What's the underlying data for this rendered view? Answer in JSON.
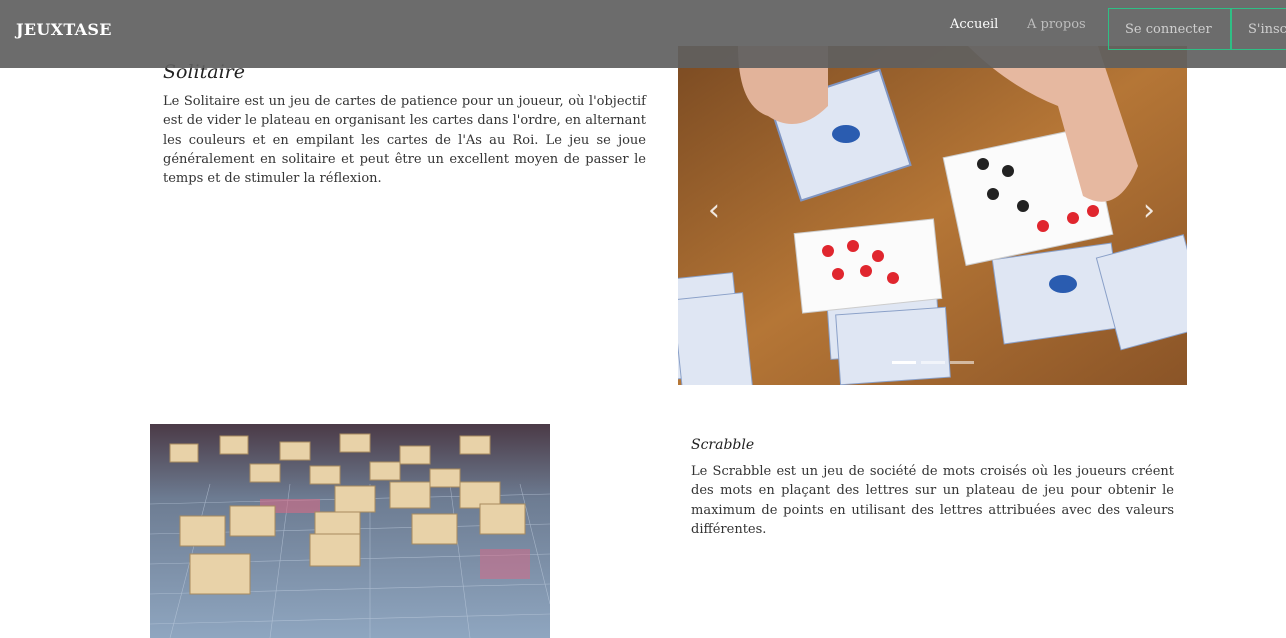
{
  "navbar": {
    "brand": "JEUXTASE",
    "links": [
      {
        "label": "Accueil",
        "active": true
      },
      {
        "label": "A propos",
        "active": false
      }
    ],
    "login_button": "Se connecter",
    "signup_button": "S'inscrire",
    "accent_color": "#2fbf85"
  },
  "solitaire": {
    "title": "Solitaire",
    "description": "Le Solitaire est un jeu de cartes de patience pour un joueur, où l'objectif est de vider le plateau en organisant les cartes dans l'ordre, en alternant les couleurs et en empilant les cartes de l'As au Roi. Le jeu se joue généralement en solitaire et peut être un excellent moyen de passer le temps et de stimuler la réflexion."
  },
  "carousel": {
    "slide_count": 3,
    "active_index": 0,
    "prev_icon": "chevron-left-icon",
    "next_icon": "chevron-right-icon"
  },
  "scrabble": {
    "title": "Scrabble",
    "description": "Le Scrabble est un jeu de société de mots croisés où les joueurs créent des mots en plaçant des lettres sur un plateau de jeu pour obtenir le maximum de points en utilisant des lettres attribuées avec des valeurs différentes."
  }
}
